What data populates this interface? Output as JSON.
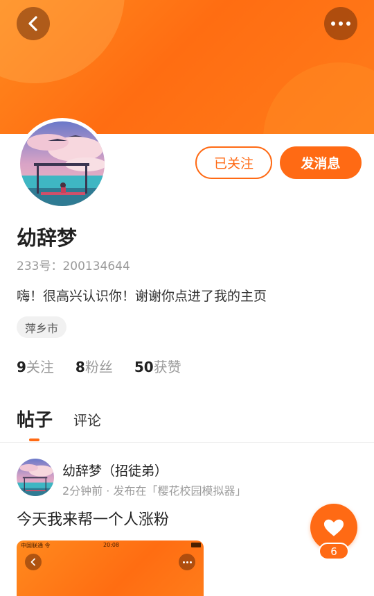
{
  "profile": {
    "name": "幼辞梦",
    "uid_label": "233号：200134644",
    "bio": "嗨！很高兴认识你！谢谢你点进了我的主页",
    "location": "萍乡市"
  },
  "actions": {
    "followed_label": "已关注",
    "message_label": "发消息"
  },
  "stats": {
    "following_count": "9",
    "following_label": "关注",
    "fans_count": "8",
    "fans_label": "粉丝",
    "likes_count": "50",
    "likes_label": "获赞"
  },
  "tabs": {
    "posts": "帖子",
    "comments": "评论"
  },
  "post": {
    "author": "幼辞梦（招徒弟）",
    "meta": "2分钟前 · 发布在「樱花校园模拟器」",
    "text": "今天我来帮一个人涨粉",
    "like_count": "6",
    "image_time": "20:08",
    "image_status": "中国联通 令"
  },
  "icons": {
    "back": "chevron-left-icon",
    "more": "more-dots-icon",
    "like": "heart-icon"
  },
  "colors": {
    "accent": "#ff6a14",
    "banner": "#ff7a1a",
    "muted_text": "#9a9a9a"
  }
}
